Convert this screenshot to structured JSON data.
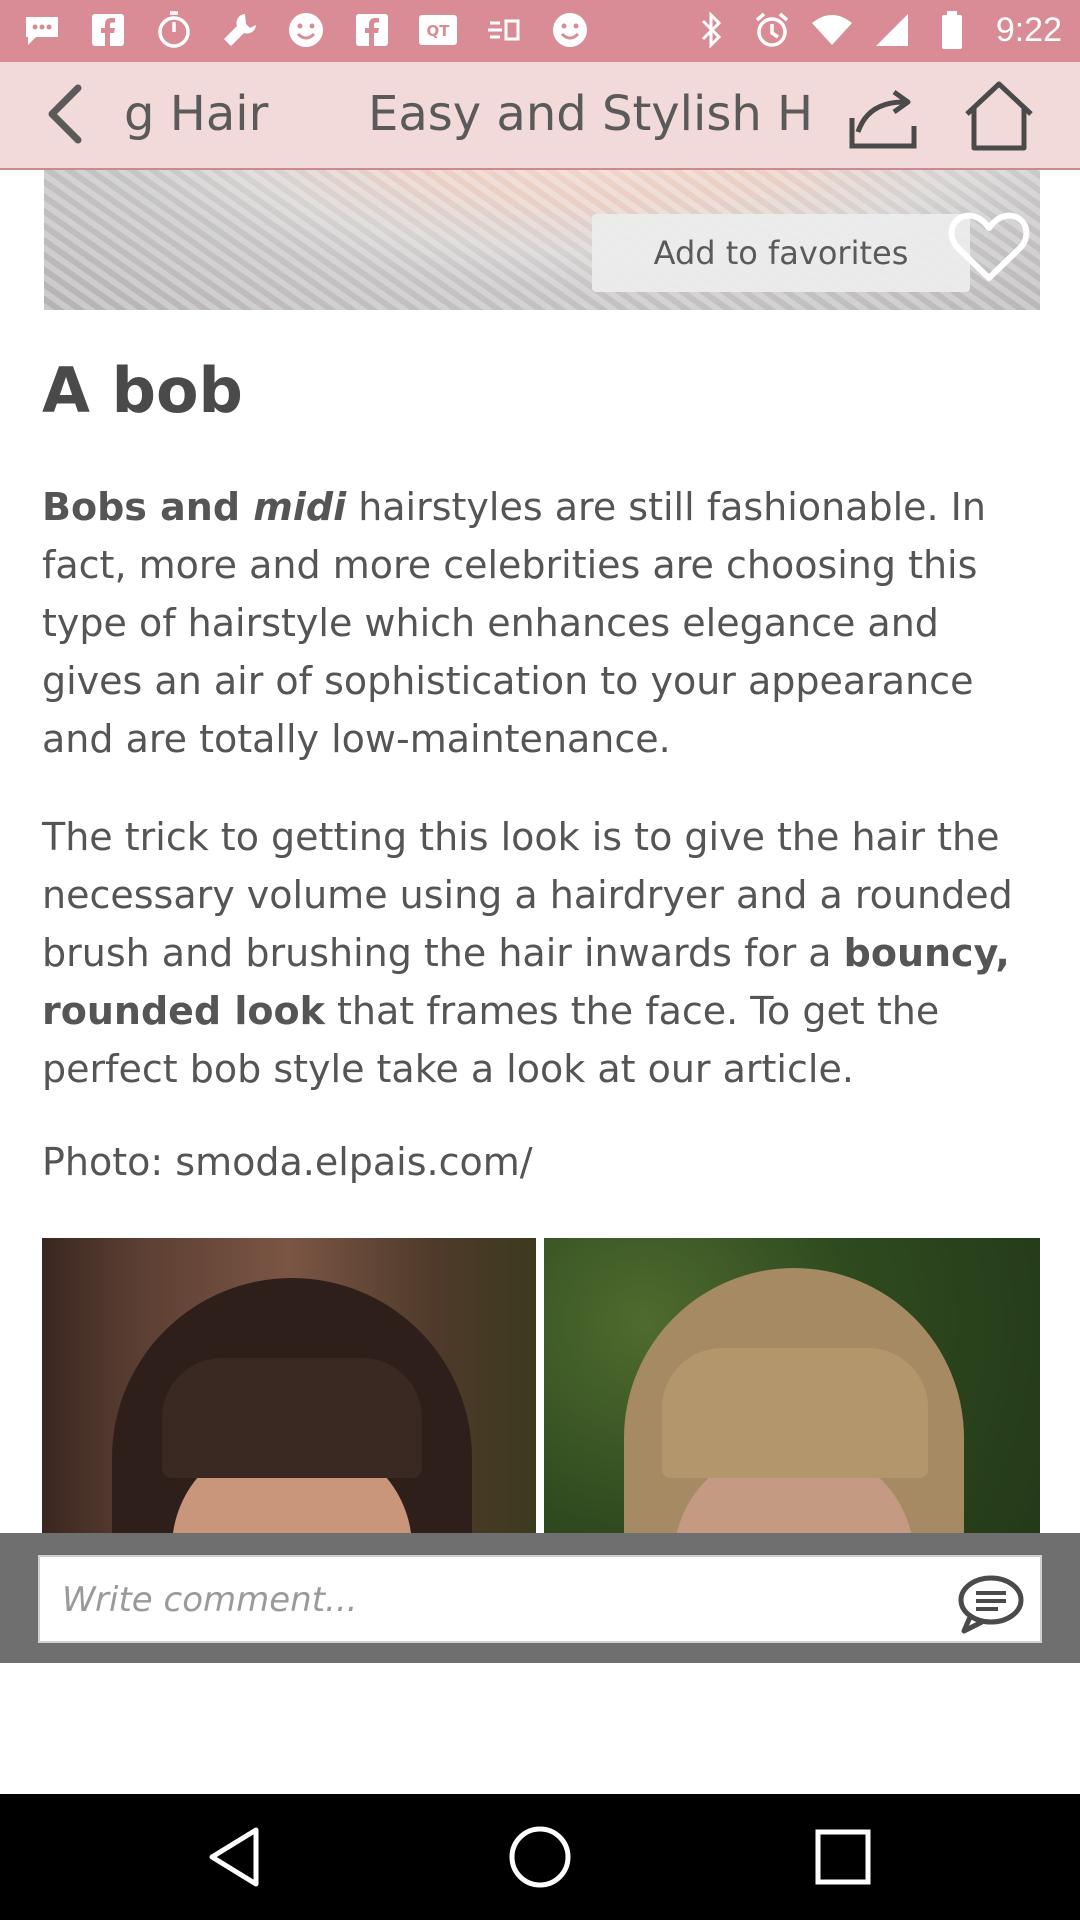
{
  "status_bar": {
    "time": "9:22",
    "icons": [
      "chat-bubble-icon",
      "facebook-icon",
      "timer-icon",
      "wrench-icon",
      "smiley-icon",
      "facebook-icon",
      "qq-icon",
      "weather-icon",
      "smiley-icon",
      "bluetooth-icon",
      "alarm-icon",
      "wifi-icon",
      "signal-icon",
      "battery-icon"
    ]
  },
  "app_bar": {
    "prev_tab": "g Hair",
    "title": "Easy and Stylish Ha"
  },
  "hero": {
    "favorites_label": "Add to favorites"
  },
  "article": {
    "heading": "A bob",
    "p1": {
      "bold1": "Bobs and ",
      "bold_italic": "midi",
      "rest": " hairstyles are still fashionable. In fact, more and more celebrities are choosing this type of hairstyle which enhances elegance and gives an air of sophistication to your appearance and are totally low-maintenance."
    },
    "p2": {
      "lead": "The trick to getting this look is to give the hair the necessary volume using a hairdryer and a rounded brush and brushing the hair inwards for a ",
      "bold": "bouncy, rounded look",
      "rest": " that frames the face. To get the perfect bob style take a look at our article."
    },
    "credit": "Photo: smoda.elpais.com/"
  },
  "comment": {
    "placeholder": "Write comment..."
  },
  "colors": {
    "status_bar": "#d98c95",
    "app_bar": "#f2d9da",
    "text": "#555555"
  }
}
